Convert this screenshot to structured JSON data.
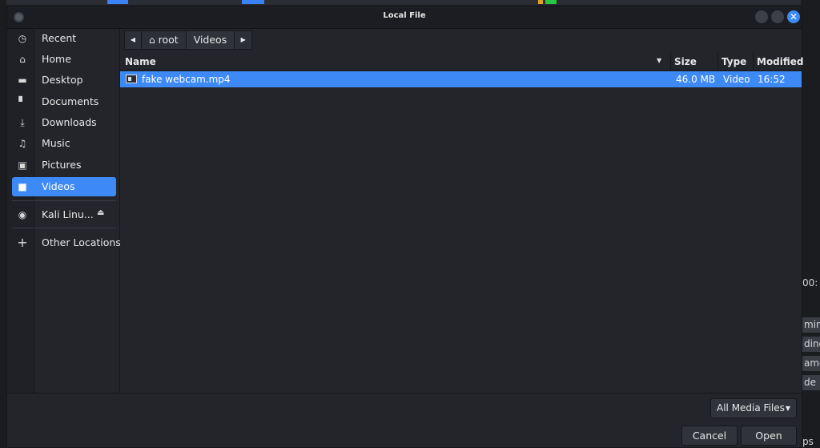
{
  "window": {
    "title": "Local File"
  },
  "background": {
    "right_buttons": [
      "ming",
      "ding",
      "ame",
      "de"
    ],
    "right_text": "00:",
    "right_bottom_text": "ps"
  },
  "sidebar": {
    "items": [
      {
        "label": "Recent",
        "icon": "clock-icon"
      },
      {
        "label": "Home",
        "icon": "home-icon"
      },
      {
        "label": "Desktop",
        "icon": "desktop-icon"
      },
      {
        "label": "Documents",
        "icon": "document-icon"
      },
      {
        "label": "Downloads",
        "icon": "download-icon"
      },
      {
        "label": "Music",
        "icon": "music-icon"
      },
      {
        "label": "Pictures",
        "icon": "picture-icon"
      },
      {
        "label": "Videos",
        "icon": "video-icon",
        "active": true
      }
    ],
    "devices": [
      {
        "label": "Kali Linu...",
        "icon": "disc-icon",
        "eject_icon": "eject-icon"
      }
    ],
    "other": {
      "label": "Other Locations",
      "icon": "plus-icon"
    }
  },
  "pathbar": {
    "segments": [
      "root",
      "Videos"
    ]
  },
  "filelist": {
    "columns": [
      "Name",
      "Size",
      "Type",
      "Modified"
    ],
    "rows": [
      {
        "name": "fake webcam.mp4",
        "size": "46.0 MB",
        "type": "Video",
        "modified": "16:52",
        "selected": true
      }
    ]
  },
  "footer": {
    "filter": "All Media Files",
    "cancel_label": "Cancel",
    "open_label": "Open"
  },
  "colors": {
    "accent": "#3d8af7",
    "background": "#23252b"
  }
}
